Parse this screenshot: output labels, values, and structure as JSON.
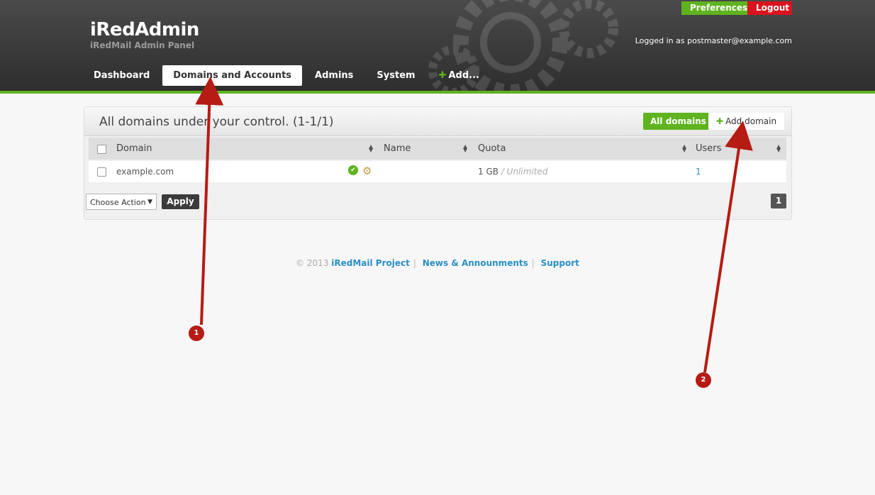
{
  "header": {
    "title": "iRedAdmin",
    "subtitle": "iRedMail Admin Panel",
    "logged_in": "Logged in as postmaster@example.com",
    "preferences": "Preferences",
    "logout": "Logout",
    "nav": [
      "Dashboard",
      "Domains and Accounts",
      "Admins",
      "System",
      "Add..."
    ]
  },
  "panel": {
    "title": "All domains under your control. (1-1/1)",
    "all_domains": "All domains",
    "add_domain": "Add domain",
    "columns": [
      "Domain",
      "Name",
      "Quota",
      "Users"
    ],
    "rows": [
      {
        "domain": "example.com",
        "name": "",
        "quota": "1 GB",
        "quota_limit": "/ Unlimited",
        "users": "1"
      }
    ],
    "action_select": "Choose Action",
    "apply": "Apply",
    "page": "1"
  },
  "footer": {
    "copyright": "© 2013",
    "links": [
      "iRedMail Project",
      "News & Announments",
      "Support"
    ]
  },
  "annotations": [
    "1",
    "2"
  ],
  "colors": {
    "accent": "#5fb31f",
    "danger": "#d9141e",
    "header": "#333333",
    "annotation": "#b61b14"
  }
}
